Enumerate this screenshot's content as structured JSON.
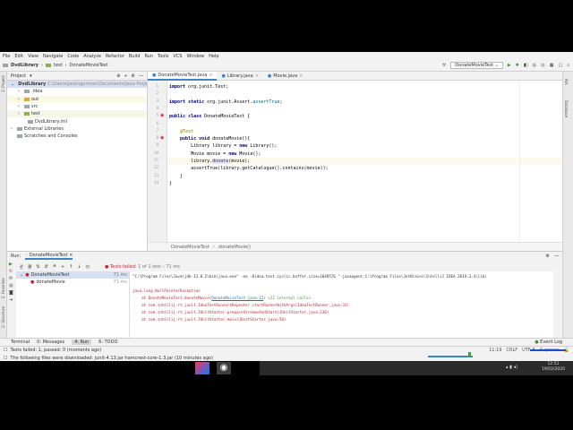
{
  "menu": [
    "File",
    "Edit",
    "View",
    "Navigate",
    "Code",
    "Analyze",
    "Refactor",
    "Build",
    "Run",
    "Tools",
    "VCS",
    "Window",
    "Help"
  ],
  "nav": {
    "project": "DvdLibrary",
    "folder": "test",
    "file": "DonateMovieTest",
    "run_config": "DonateMovieTest"
  },
  "sidebar_left": {
    "project": "1: Project",
    "favorites": "2: Favorites",
    "structure": "2: Structure"
  },
  "sidebar_right": {
    "ant": "Ant",
    "database": "Database"
  },
  "project_panel": {
    "title": "Project",
    "items": [
      {
        "label": "DvdLibrary",
        "path": "C:\\Users\\jasongorman\\Documents\\Java Projects\\D",
        "type": "module"
      },
      {
        "label": ".idea",
        "type": "folder"
      },
      {
        "label": "out",
        "type": "folder-orange"
      },
      {
        "label": "src",
        "type": "folder"
      },
      {
        "label": "test",
        "type": "folder-green"
      },
      {
        "label": "DvdLibrary.iml",
        "type": "file"
      },
      {
        "label": "External Libraries",
        "type": "lib"
      },
      {
        "label": "Scratches and Consoles",
        "type": "scratch"
      }
    ]
  },
  "editor": {
    "tabs": [
      "DonateMovieTest.java",
      "Library.java",
      "Movie.java"
    ],
    "lines": [
      [
        [
          "kw",
          "import "
        ],
        [
          "pl",
          "org.junit.Test;"
        ]
      ],
      [],
      [
        [
          "kw",
          "import static "
        ],
        [
          "pl",
          "org.junit.Assert."
        ],
        [
          "fn",
          "assertTrue"
        ],
        [
          "pl",
          ";"
        ]
      ],
      [],
      [
        [
          "kw",
          "public class "
        ],
        [
          "pl",
          "DonateMovieTest {"
        ]
      ],
      [],
      [
        [
          "an",
          "    @Test"
        ]
      ],
      [
        [
          "kw",
          "    public void "
        ],
        [
          "pl",
          "donateMovie(){"
        ]
      ],
      [
        [
          "pl",
          "        Library library = "
        ],
        [
          "kw",
          "new "
        ],
        [
          "pl",
          "Library();"
        ]
      ],
      [
        [
          "pl",
          "        Movie movie = "
        ],
        [
          "kw",
          "new "
        ],
        [
          "pl",
          "Movie();"
        ]
      ],
      [
        [
          "pl",
          "        library."
        ],
        [
          "hl",
          "donate"
        ],
        [
          "pl",
          "(movie);"
        ]
      ],
      [
        [
          "pl",
          "        assertTrue(library.getCatalogue().contains(movie));"
        ]
      ],
      [
        [
          "pl",
          "    }"
        ]
      ],
      [
        [
          "pl",
          "}"
        ]
      ]
    ],
    "breadcrumb": [
      "DonateMovieTest",
      "donateMovie()"
    ]
  },
  "run": {
    "label": "Run:",
    "tab": "DonateMovieTest",
    "status": "Tests failed:",
    "status_count": "1 of 1 test – 71 ms",
    "tree": [
      {
        "name": "DonateMovieTest",
        "time": "71 ms"
      },
      {
        "name": "donateMovie",
        "time": "71 ms"
      }
    ],
    "console": [
      "\"C:\\Program Files\\Java\\jdk-13.0.2\\bin\\java.exe\" -ea -Didea.test.cyclic.buffer.size=1048576 \"-javaagent:C:\\Program Files\\JetBrains\\IntelliJ IDEA 2019.3.4\\lib\\",
      "",
      "java.lang.NullPointerException",
      "    at DonateMovieTest.donateMovie(",
      "    at com.intellij.rt.junit.IdeaTestRunner$Repeater.startRunnerWithArgs(IdeaTestRunner.java:33)",
      "    at com.intellij.rt.junit.JUnitStarter.prepareStreamsAndStart(JUnitStarter.java:230)",
      "    at com.intellij.rt.junit.JUnitStarter.main(JUnitStarter.java:58)"
    ],
    "console_link": "DonateMovieTest.java:12",
    "console_link_tail": ") <22 internal calls>"
  },
  "bottom_tabs": [
    "Terminal",
    "0: Messages",
    "4: Run",
    "6: TODO"
  ],
  "event_log": "Event Log",
  "status": {
    "message": "Tests failed: 1, passed: 0 (moments ago)",
    "notification": "The following files were downloaded: junit-4.13.jar hamcrest-core-1.3.jar (10 minutes ago)",
    "position": "11:19",
    "line_sep": "CRLF",
    "encoding": "UTF-8",
    "indent": "4 spaces"
  },
  "taskbar": {
    "time": "12:51",
    "date": "19/02/2020"
  }
}
